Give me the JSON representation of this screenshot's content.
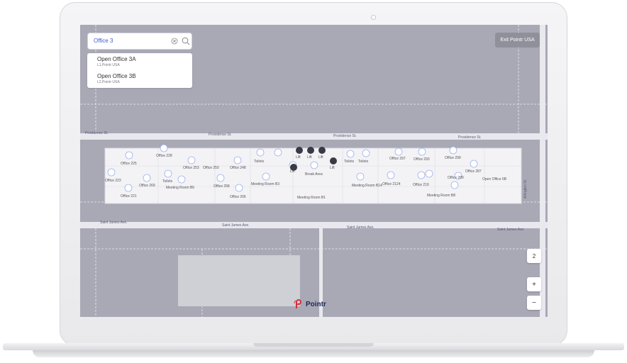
{
  "search": {
    "value": "Office 3",
    "clear_icon": "clear-circle-icon",
    "search_icon": "magnifier-icon"
  },
  "results": [
    {
      "title": "Open Office 3A",
      "subtitle": "L1,Pointr USA"
    },
    {
      "title": "Open Office 3B",
      "subtitle": "L2,Pointr USA"
    }
  ],
  "exit_button": "Exit Pointr USA",
  "floor_selector": "2",
  "zoom_in": "+",
  "zoom_out": "−",
  "logo": "Pointr",
  "streets": {
    "providence": "Providence St.",
    "saint_james": "Saint James Ave.",
    "arlington": "Arlington St."
  },
  "rooms": [
    "Office 225",
    "Office 228",
    "Office 223",
    "Office 269",
    "Office 221",
    "Office 253",
    "Office 250",
    "Office 248",
    "Meeting Room B6",
    "Office 258",
    "Office 206",
    "Toilets",
    "Toilets",
    "Meeting Room B3",
    "Lift",
    "Lift",
    "Lift",
    "Lift",
    "Lift",
    "Break Area",
    "Meeting Room B1",
    "Toilets",
    "Toilets",
    "Meeting Room B14",
    "Office 2124",
    "Office 297",
    "Office 293",
    "Office 299",
    "Office 219",
    "Office 289",
    "Office 287",
    "Meeting Room B8",
    "Open Office 6B"
  ],
  "colors": {
    "map_bg": "#a9a8b5",
    "road": "#e6e6ec",
    "building": "#f4f4f6",
    "accent": "#3f5bcc",
    "exit_button": "#90909b"
  }
}
